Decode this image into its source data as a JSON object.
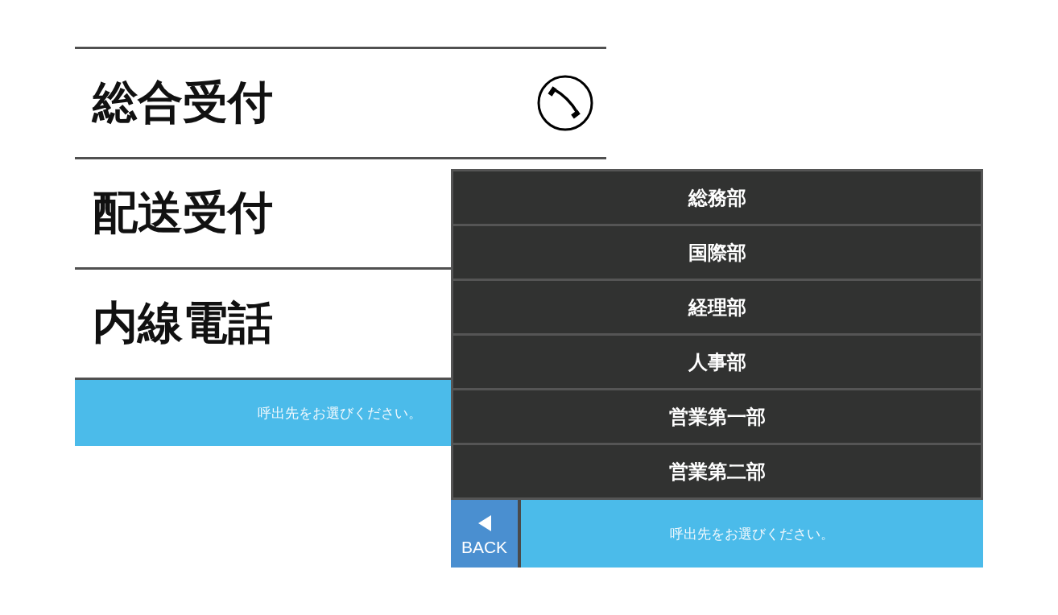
{
  "reception_screen": {
    "items": [
      {
        "label": "総合受付",
        "kind": "call"
      },
      {
        "label": "配送受付",
        "kind": "menu"
      },
      {
        "label": "内線電話",
        "kind": "menu"
      }
    ],
    "status_bar": {
      "message": "呼出先をお選びください。"
    }
  },
  "department_screen": {
    "items": [
      {
        "label": "総務部"
      },
      {
        "label": "国際部"
      },
      {
        "label": "経理部"
      },
      {
        "label": "人事部"
      },
      {
        "label": "営業第一部"
      },
      {
        "label": "営業第二部"
      }
    ],
    "back_button": {
      "label": "BACK"
    },
    "status_bar": {
      "message": "呼出先をお選びください。"
    }
  }
}
